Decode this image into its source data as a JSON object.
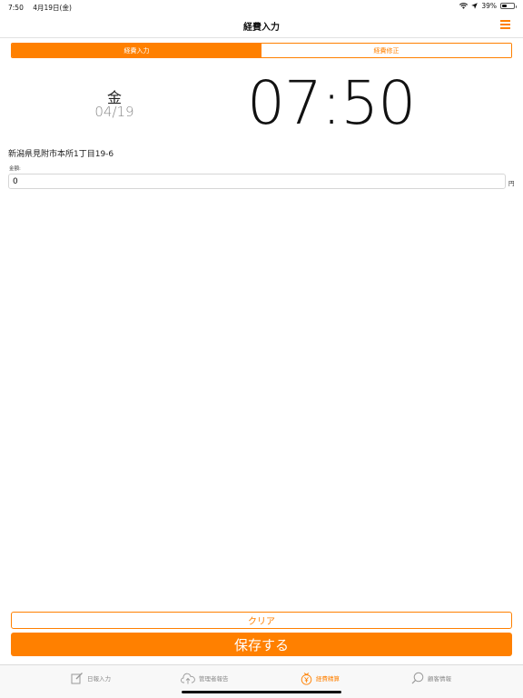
{
  "status_bar": {
    "time": "7:50",
    "date": "4月19日(金)",
    "battery": "39%",
    "battery_level": 0.39
  },
  "nav": {
    "title": "経費入力"
  },
  "segments": [
    {
      "label": "経費入力",
      "active": true
    },
    {
      "label": "経費修正",
      "active": false
    }
  ],
  "datetime": {
    "weekday": "金",
    "date": "04/19",
    "time": "07:50"
  },
  "address": "新潟県見附市本所1丁目19-6",
  "amount": {
    "label": "金額:",
    "value": "0",
    "unit": "円"
  },
  "buttons": {
    "clear": "クリア",
    "save": "保存する"
  },
  "tabs": [
    {
      "label": "日報入力",
      "icon": "edit-icon",
      "active": false
    },
    {
      "label": "管理者報告",
      "icon": "cloud-upload-icon",
      "active": false
    },
    {
      "label": "経費精算",
      "icon": "yen-coin-icon",
      "active": true
    },
    {
      "label": "顧客情報",
      "icon": "search-icon",
      "active": false
    }
  ],
  "colors": {
    "accent": "#ff8000",
    "inactive": "#888888"
  }
}
